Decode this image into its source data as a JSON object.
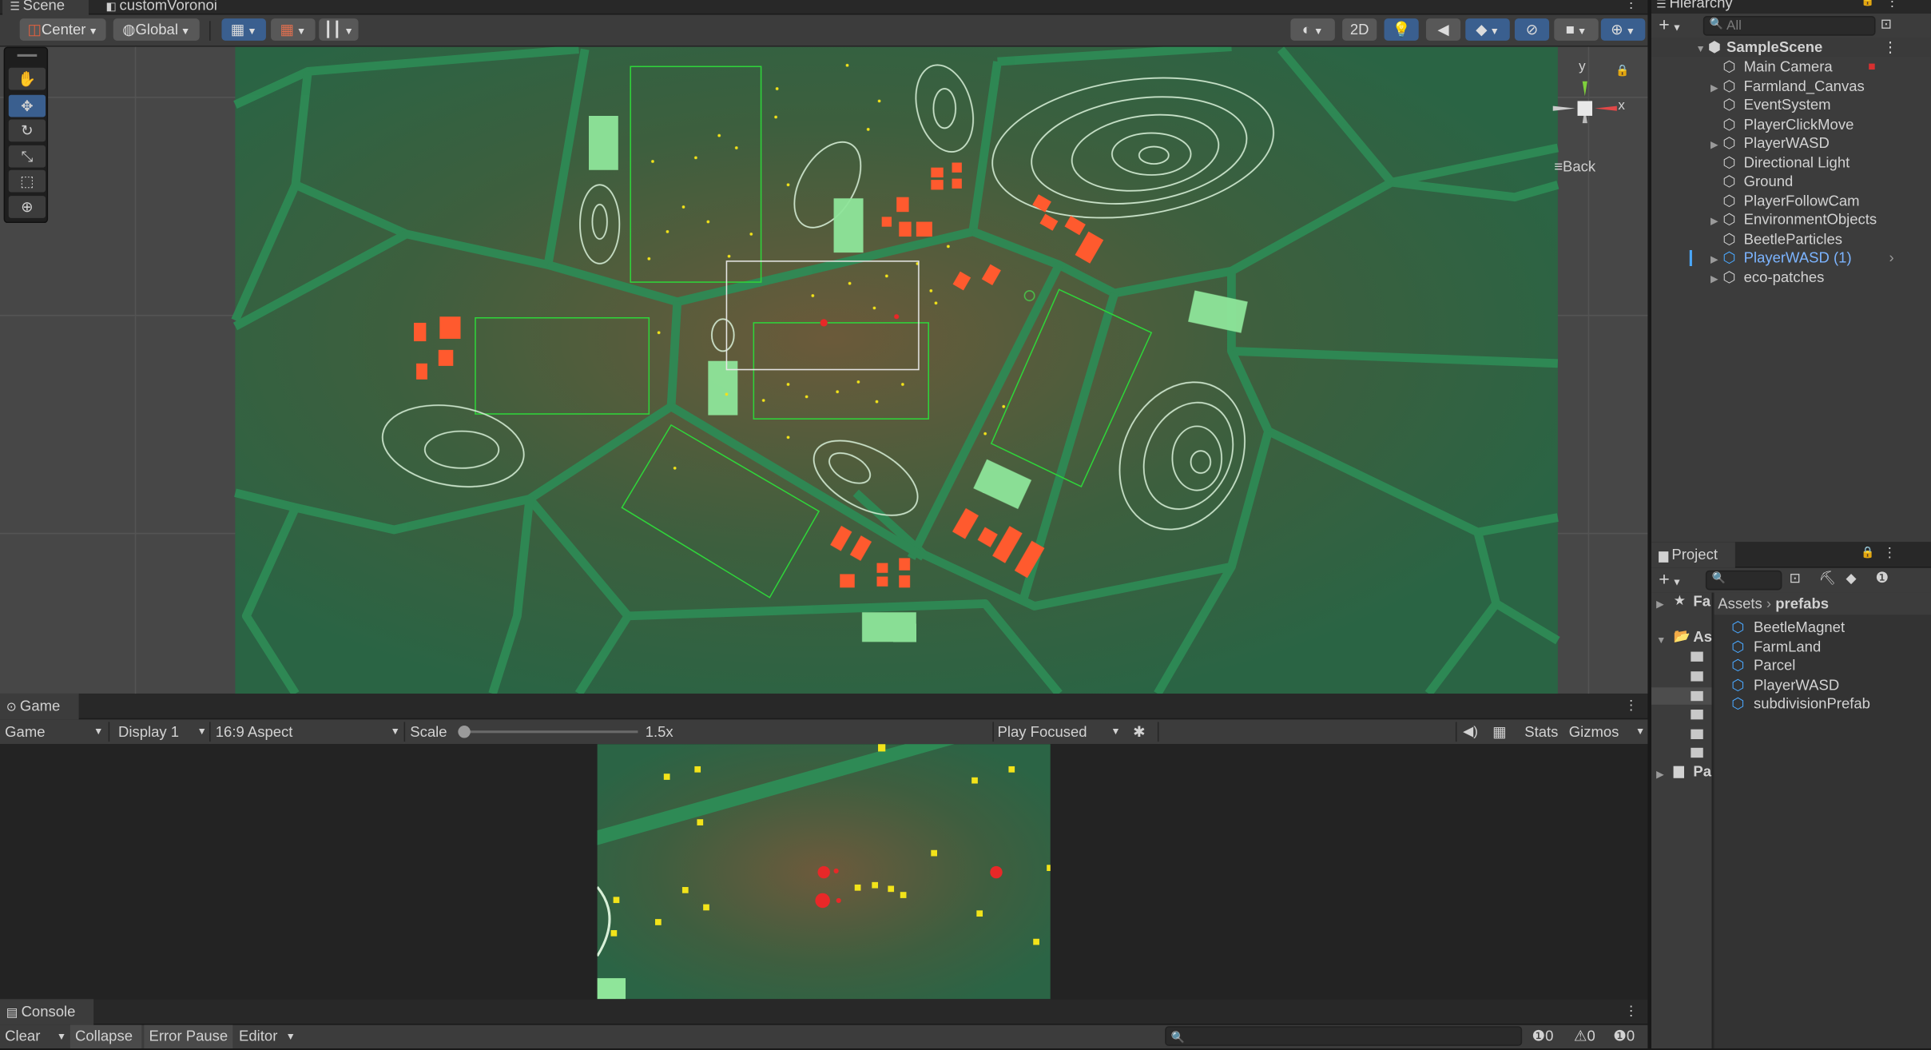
{
  "scene_tab": {
    "label": "Scene",
    "second_tab": "customVoronoi"
  },
  "scene_toolbar": {
    "pivot": "Center",
    "space": "Global",
    "mode_2d": "2D"
  },
  "gizmo": {
    "y": "y",
    "x": "x",
    "back": "Back"
  },
  "hierarchy": {
    "title": "Hierarchy",
    "search_placeholder": "All",
    "scene": "SampleScene",
    "items": [
      {
        "label": "Main Camera",
        "expandable": false
      },
      {
        "label": "Farmland_Canvas",
        "expandable": true
      },
      {
        "label": "EventSystem",
        "expandable": false
      },
      {
        "label": "PlayerClickMove",
        "expandable": false
      },
      {
        "label": "PlayerWASD",
        "expandable": true
      },
      {
        "label": "Directional Light",
        "expandable": false
      },
      {
        "label": "Ground",
        "expandable": false
      },
      {
        "label": "PlayerFollowCam",
        "expandable": false
      },
      {
        "label": "EnvironmentObjects",
        "expandable": true
      },
      {
        "label": "BeetleParticles",
        "expandable": false
      },
      {
        "label": "PlayerWASD (1)",
        "expandable": true,
        "selected_color": "#7cb4ff"
      },
      {
        "label": "eco-patches",
        "expandable": true
      }
    ]
  },
  "project": {
    "title": "Project",
    "tree": [
      "Fa",
      "As",
      "Pa"
    ],
    "breadcrumb_root": "Assets",
    "breadcrumb_leaf": "prefabs",
    "files": [
      "BeetleMagnet",
      "FarmLand",
      "Parcel",
      "PlayerWASD",
      "subdivisionPrefab"
    ]
  },
  "game": {
    "tab": "Game",
    "mode": "Game",
    "display": "Display 1",
    "aspect": "16:9 Aspect",
    "scale_label": "Scale",
    "scale_value": "1.5x",
    "play_focused": "Play Focused",
    "stats": "Stats",
    "gizmos": "Gizmos"
  },
  "console": {
    "tab": "Console",
    "clear": "Clear",
    "collapse": "Collapse",
    "error_pause": "Error Pause",
    "editor": "Editor",
    "log_count": "0",
    "warn_count": "0",
    "error_count": "0"
  },
  "colors": {
    "ground": "#2e6b45",
    "edge": "#2d8a55",
    "farm": "#8fe59a",
    "building": "#ff5a2e",
    "beetle": "#f2e31a",
    "player": "#e82828",
    "accent": "#3a5f8f"
  }
}
